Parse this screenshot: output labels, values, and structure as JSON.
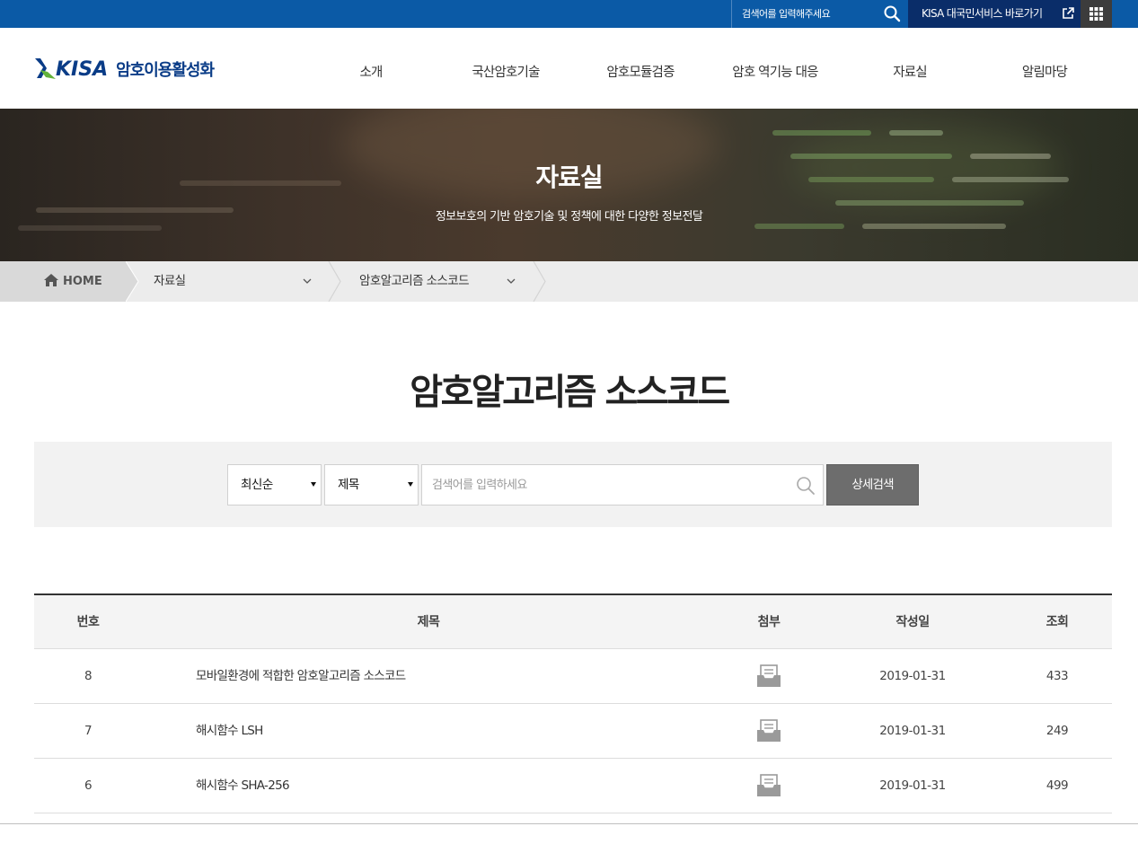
{
  "topbar": {
    "search_placeholder": "검색어를 입력해주세요",
    "kisa_link": "KISA 대국민서비스 바로가기",
    "icons": [
      "search-icon",
      "external-link-icon",
      "apps-grid-icon"
    ],
    "bg_color": "#0b5aa6"
  },
  "header": {
    "logo_brand": "KISA",
    "logo_text": "암호이용활성화",
    "nav": [
      "소개",
      "국산암호기술",
      "암호모듈검증",
      "암호 역기능 대응",
      "자료실",
      "알림마당"
    ]
  },
  "banner": {
    "title": "자료실",
    "subtitle": "정보보호의 기반 암호기술 및 정책에 대한 다양한 정보전달"
  },
  "breadcrumb": {
    "home": "HOME",
    "level1": "자료실",
    "level2": "암호알고리즘 소스코드"
  },
  "page_title": "암호알고리즘 소스코드",
  "search": {
    "sort_selected": "최신순",
    "field_selected": "제목",
    "placeholder": "검색어를 입력하세요",
    "detail_button": "상세검색"
  },
  "table": {
    "headers": [
      "번호",
      "제목",
      "첨부",
      "작성일",
      "조회"
    ],
    "rows": [
      {
        "no": "8",
        "title": "모바일환경에 적합한 암호알고리즘 소스코드",
        "date": "2019-01-31",
        "views": "433"
      },
      {
        "no": "7",
        "title": "해시함수 LSH",
        "date": "2019-01-31",
        "views": "249"
      },
      {
        "no": "6",
        "title": "해시함수 SHA-256",
        "date": "2019-01-31",
        "views": "499"
      }
    ]
  }
}
